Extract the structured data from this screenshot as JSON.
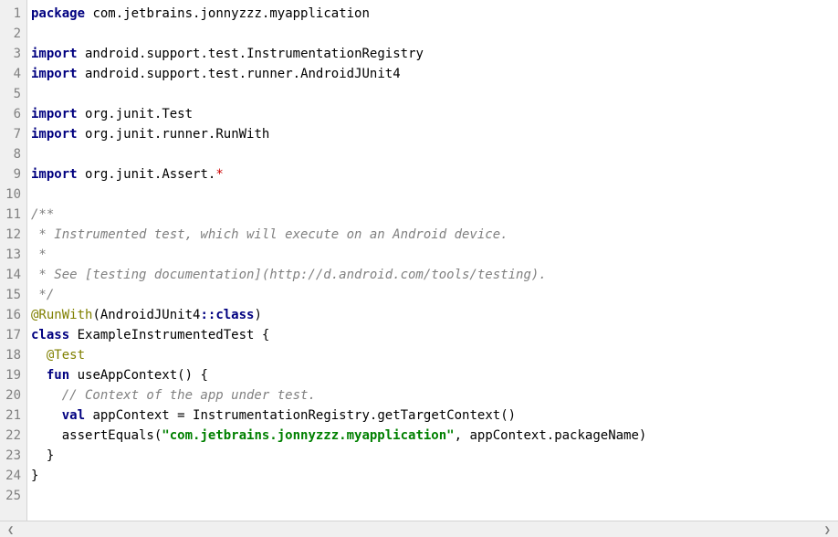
{
  "lines": [
    {
      "n": "1",
      "tokens": [
        {
          "c": "kw",
          "t": "package"
        },
        {
          "c": "pkg",
          "t": " com"
        },
        {
          "c": "dot",
          "t": "."
        },
        {
          "c": "pkg",
          "t": "jetbrains"
        },
        {
          "c": "dot",
          "t": "."
        },
        {
          "c": "pkg",
          "t": "jonnyzzz"
        },
        {
          "c": "dot",
          "t": "."
        },
        {
          "c": "pkg",
          "t": "myapplication"
        }
      ]
    },
    {
      "n": "2",
      "tokens": []
    },
    {
      "n": "3",
      "tokens": [
        {
          "c": "kw",
          "t": "import"
        },
        {
          "c": "pkg",
          "t": " android"
        },
        {
          "c": "dot",
          "t": "."
        },
        {
          "c": "pkg",
          "t": "support"
        },
        {
          "c": "dot",
          "t": "."
        },
        {
          "c": "pkg",
          "t": "test"
        },
        {
          "c": "dot",
          "t": "."
        },
        {
          "c": "cls",
          "t": "InstrumentationRegistry"
        }
      ]
    },
    {
      "n": "4",
      "tokens": [
        {
          "c": "kw",
          "t": "import"
        },
        {
          "c": "pkg",
          "t": " android"
        },
        {
          "c": "dot",
          "t": "."
        },
        {
          "c": "pkg",
          "t": "support"
        },
        {
          "c": "dot",
          "t": "."
        },
        {
          "c": "pkg",
          "t": "test"
        },
        {
          "c": "dot",
          "t": "."
        },
        {
          "c": "pkg",
          "t": "runner"
        },
        {
          "c": "dot",
          "t": "."
        },
        {
          "c": "cls",
          "t": "AndroidJUnit4"
        }
      ]
    },
    {
      "n": "5",
      "tokens": []
    },
    {
      "n": "6",
      "tokens": [
        {
          "c": "kw",
          "t": "import"
        },
        {
          "c": "pkg",
          "t": " org"
        },
        {
          "c": "dot",
          "t": "."
        },
        {
          "c": "pkg",
          "t": "junit"
        },
        {
          "c": "dot",
          "t": "."
        },
        {
          "c": "cls",
          "t": "Test"
        }
      ]
    },
    {
      "n": "7",
      "tokens": [
        {
          "c": "kw",
          "t": "import"
        },
        {
          "c": "pkg",
          "t": " org"
        },
        {
          "c": "dot",
          "t": "."
        },
        {
          "c": "pkg",
          "t": "junit"
        },
        {
          "c": "dot",
          "t": "."
        },
        {
          "c": "pkg",
          "t": "runner"
        },
        {
          "c": "dot",
          "t": "."
        },
        {
          "c": "cls",
          "t": "RunWith"
        }
      ]
    },
    {
      "n": "8",
      "tokens": []
    },
    {
      "n": "9",
      "tokens": [
        {
          "c": "kw",
          "t": "import"
        },
        {
          "c": "pkg",
          "t": " org"
        },
        {
          "c": "dot",
          "t": "."
        },
        {
          "c": "pkg",
          "t": "junit"
        },
        {
          "c": "dot",
          "t": "."
        },
        {
          "c": "cls",
          "t": "Assert"
        },
        {
          "c": "dot",
          "t": "."
        },
        {
          "c": "star",
          "t": "*"
        }
      ]
    },
    {
      "n": "10",
      "tokens": []
    },
    {
      "n": "11",
      "tokens": [
        {
          "c": "com",
          "t": "/**"
        }
      ]
    },
    {
      "n": "12",
      "tokens": [
        {
          "c": "com",
          "t": " * Instrumented test, which will execute on an Android device."
        }
      ]
    },
    {
      "n": "13",
      "tokens": [
        {
          "c": "com",
          "t": " *"
        }
      ]
    },
    {
      "n": "14",
      "tokens": [
        {
          "c": "com",
          "t": " * See [testing documentation](http://d.android.com/tools/testing)."
        }
      ]
    },
    {
      "n": "15",
      "tokens": [
        {
          "c": "com",
          "t": " */"
        }
      ]
    },
    {
      "n": "16",
      "tokens": [
        {
          "c": "ann",
          "t": "@RunWith"
        },
        {
          "c": "paren",
          "t": "("
        },
        {
          "c": "cls",
          "t": "AndroidJUnit4"
        },
        {
          "c": "dcolon",
          "t": "::"
        },
        {
          "c": "kw",
          "t": "class"
        },
        {
          "c": "paren",
          "t": ")"
        }
      ]
    },
    {
      "n": "17",
      "tokens": [
        {
          "c": "kw",
          "t": "class"
        },
        {
          "c": "cls",
          "t": " ExampleInstrumentedTest "
        },
        {
          "c": "brace",
          "t": "{"
        }
      ]
    },
    {
      "n": "18",
      "tokens": [
        {
          "c": "extra-text",
          "t": "  "
        },
        {
          "c": "ann",
          "t": "@Test"
        }
      ]
    },
    {
      "n": "19",
      "tokens": [
        {
          "c": "extra-text",
          "t": "  "
        },
        {
          "c": "kw",
          "t": "fun"
        },
        {
          "c": "extra-text",
          "t": " useAppContext"
        },
        {
          "c": "paren",
          "t": "()"
        },
        {
          "c": "extra-text",
          "t": " "
        },
        {
          "c": "brace",
          "t": "{"
        }
      ]
    },
    {
      "n": "20",
      "tokens": [
        {
          "c": "extra-text",
          "t": "    "
        },
        {
          "c": "com",
          "t": "// Context of the app under test."
        }
      ]
    },
    {
      "n": "21",
      "tokens": [
        {
          "c": "extra-text",
          "t": "    "
        },
        {
          "c": "kw",
          "t": "val"
        },
        {
          "c": "extra-text",
          "t": " appContext "
        },
        {
          "c": "op",
          "t": "="
        },
        {
          "c": "extra-text",
          "t": " InstrumentationRegistry"
        },
        {
          "c": "dot",
          "t": "."
        },
        {
          "c": "extra-text",
          "t": "getTargetContext"
        },
        {
          "c": "paren",
          "t": "()"
        }
      ]
    },
    {
      "n": "22",
      "tokens": [
        {
          "c": "extra-text",
          "t": "    assertEquals"
        },
        {
          "c": "paren",
          "t": "("
        },
        {
          "c": "str",
          "t": "\"com.jetbrains.jonnyzzz.myapplication\""
        },
        {
          "c": "op",
          "t": ","
        },
        {
          "c": "extra-text",
          "t": " appContext"
        },
        {
          "c": "dot",
          "t": "."
        },
        {
          "c": "extra-text",
          "t": "packageName"
        },
        {
          "c": "paren",
          "t": ")"
        }
      ]
    },
    {
      "n": "23",
      "tokens": [
        {
          "c": "extra-text",
          "t": "  "
        },
        {
          "c": "brace",
          "t": "}"
        }
      ]
    },
    {
      "n": "24",
      "tokens": [
        {
          "c": "brace",
          "t": "}"
        }
      ]
    },
    {
      "n": "25",
      "tokens": []
    }
  ],
  "scroll": {
    "left": "❮",
    "right": "❯"
  }
}
